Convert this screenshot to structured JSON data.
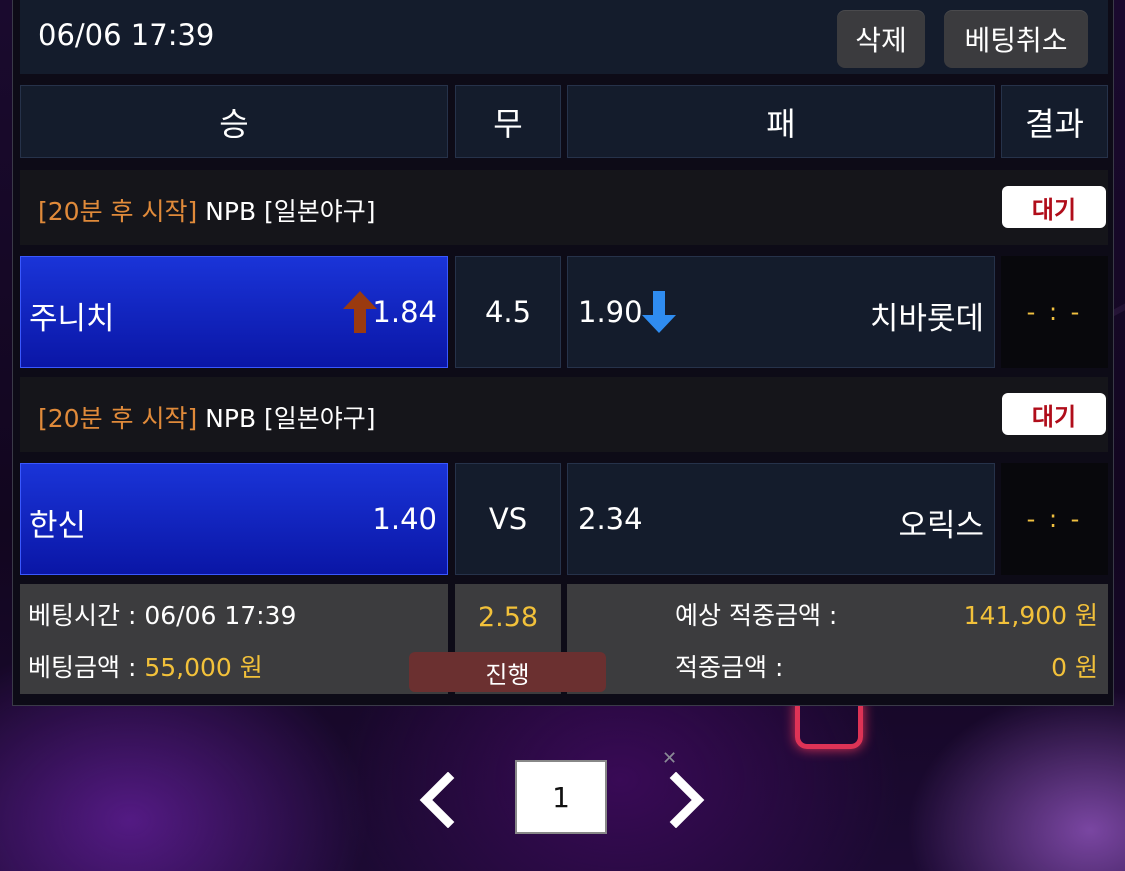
{
  "header": {
    "datetime": "06/06 17:39",
    "delete_label": "삭제",
    "cancel_bet_label": "베팅취소"
  },
  "columns": {
    "win": "승",
    "draw": "무",
    "lose": "패",
    "result": "결과"
  },
  "matches": [
    {
      "status": "[20분 후 시작]",
      "league": "NPB [일본야구]",
      "badge": "대기",
      "home_team": "주니치",
      "home_odds": "1.84",
      "home_trend": "up",
      "center": "4.5",
      "away_odds": "1.90",
      "away_trend": "down",
      "away_team": "치바롯데",
      "result": "- : -"
    },
    {
      "status": "[20분 후 시작]",
      "league": "NPB [일본야구]",
      "badge": "대기",
      "home_team": "한신",
      "home_odds": "1.40",
      "center": "VS",
      "away_odds": "2.34",
      "away_team": "오릭스",
      "result": "- : -"
    }
  ],
  "summary": {
    "bet_time_label": "베팅시간 : ",
    "bet_time_value": "06/06 17:39",
    "bet_amount_label": "베팅금액 : ",
    "bet_amount_value": "55,000 원",
    "total_odds": "2.58",
    "state": "진행",
    "expected_win_label": "예상 적중금액 :",
    "expected_win_value": "141,900 원",
    "win_amount_label": "적중금액 :",
    "win_amount_value": "0 원"
  },
  "pagination": {
    "current": "1"
  },
  "colors": {
    "selected": "#0f22c0",
    "status_orange": "#e08a3a",
    "yellow": "#f2c13a",
    "up_arrow": "#9a3a10",
    "down_arrow": "#2f8cf0",
    "badge_red": "#b00d1a"
  }
}
